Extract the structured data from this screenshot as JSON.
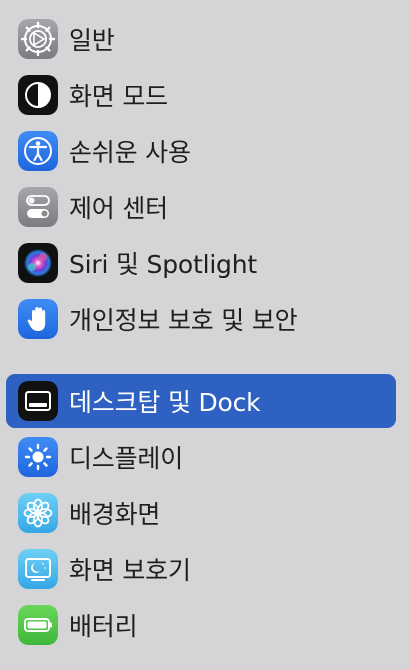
{
  "sidebar": {
    "items": [
      {
        "label": "일반",
        "icon": "gear-icon"
      },
      {
        "label": "화면 모드",
        "icon": "appearance-icon"
      },
      {
        "label": "손쉬운 사용",
        "icon": "accessibility-icon"
      },
      {
        "label": "제어 센터",
        "icon": "control-center-icon"
      },
      {
        "label": "Siri 및 Spotlight",
        "icon": "siri-icon"
      },
      {
        "label": "개인정보 보호 및 보안",
        "icon": "hand-icon"
      },
      {
        "label": "데스크탑 및 Dock",
        "icon": "dock-icon",
        "selected": true
      },
      {
        "label": "디스플레이",
        "icon": "sun-icon"
      },
      {
        "label": "배경화면",
        "icon": "flower-icon"
      },
      {
        "label": "화면 보호기",
        "icon": "screensaver-icon"
      },
      {
        "label": "배터리",
        "icon": "battery-icon"
      }
    ]
  },
  "colors": {
    "background": "#d5d5d7",
    "selected": "#2e61c2"
  }
}
